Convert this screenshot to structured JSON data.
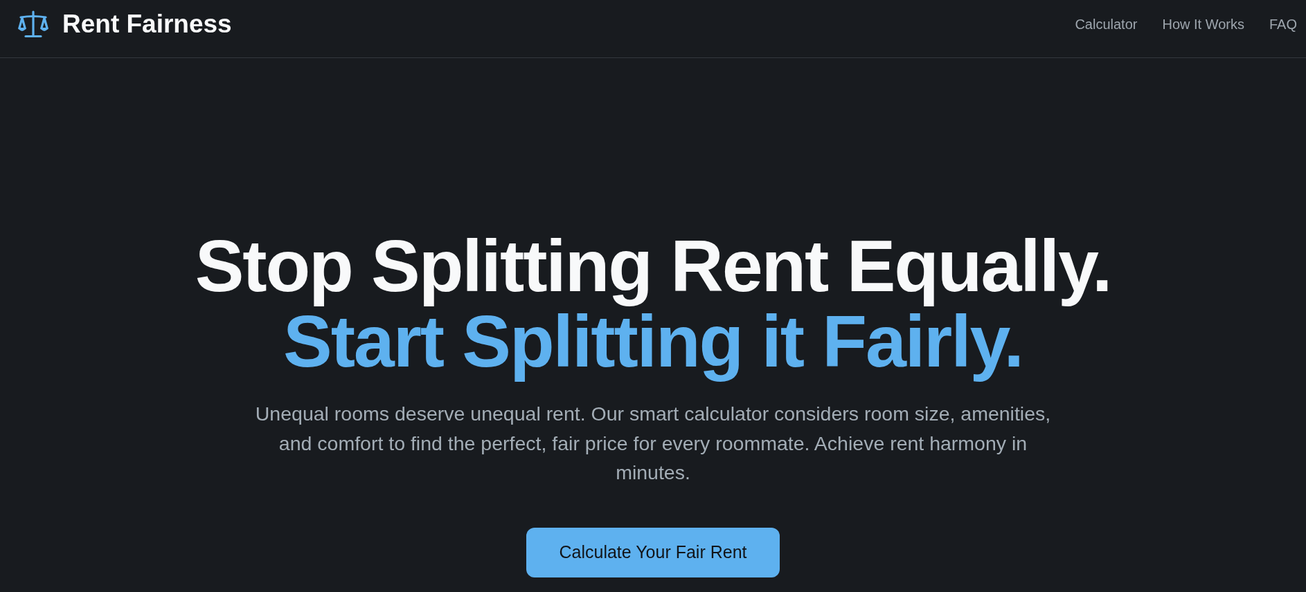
{
  "header": {
    "brand": "Rent Fairness",
    "nav": [
      {
        "label": "Calculator"
      },
      {
        "label": "How It Works"
      },
      {
        "label": "FAQ"
      }
    ]
  },
  "hero": {
    "headline": [
      {
        "text": "Stop Splitting Rent Equally.",
        "color": "#f8f9fa"
      },
      {
        "text": "Start Splitting it Fairly.",
        "color": "#5eb1ef"
      }
    ],
    "description": "Unequal rooms deserve unequal rent. Our smart calculator considers room size, amenities, and comfort to find the perfect, fair price for every roommate. Achieve rent harmony in minutes.",
    "button": "Calculate Your Fair Rent"
  }
}
